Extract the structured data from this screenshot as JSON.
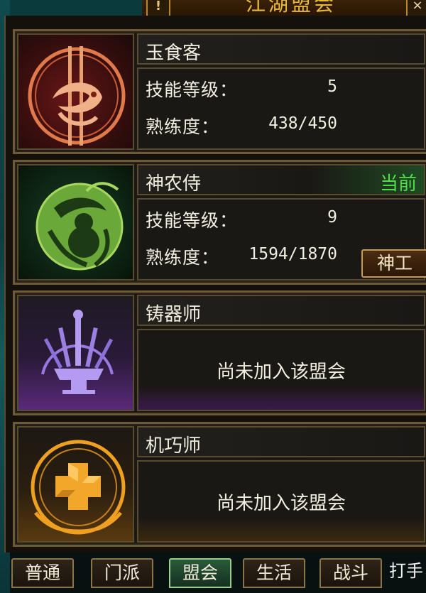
{
  "window": {
    "title": "江湖盟会",
    "help_label": "!",
    "close_label": "×"
  },
  "guilds": [
    {
      "name": "玉食客",
      "emblem": "fish-chopsticks-emblem",
      "color": "#e06a3a",
      "status": "",
      "joined": true,
      "skill_level_label": "技能等级：",
      "skill_level": "5",
      "proficiency_label": "熟练度：",
      "proficiency": "438/450",
      "action_label": ""
    },
    {
      "name": "神农侍",
      "emblem": "gourd-herb-emblem",
      "color": "#7ac640",
      "status": "当前",
      "joined": true,
      "skill_level_label": "技能等级：",
      "skill_level": "9",
      "proficiency_label": "熟练度：",
      "proficiency": "1594/1870",
      "action_label": "神工"
    },
    {
      "name": "铸器师",
      "emblem": "anvil-swords-emblem",
      "color": "#9a78e0",
      "status": "",
      "joined": false,
      "not_joined_text": "尚未加入该盟会"
    },
    {
      "name": "机巧师",
      "emblem": "gear-block-emblem",
      "color": "#f0a020",
      "status": "",
      "joined": false,
      "not_joined_text": "尚未加入该盟会"
    }
  ],
  "tabs": [
    {
      "label": "普通",
      "active": false
    },
    {
      "label": "门派",
      "active": false
    },
    {
      "label": "盟会",
      "active": true
    },
    {
      "label": "生活",
      "active": false
    },
    {
      "label": "战斗",
      "active": false
    }
  ],
  "bottom_right_text": "打手"
}
